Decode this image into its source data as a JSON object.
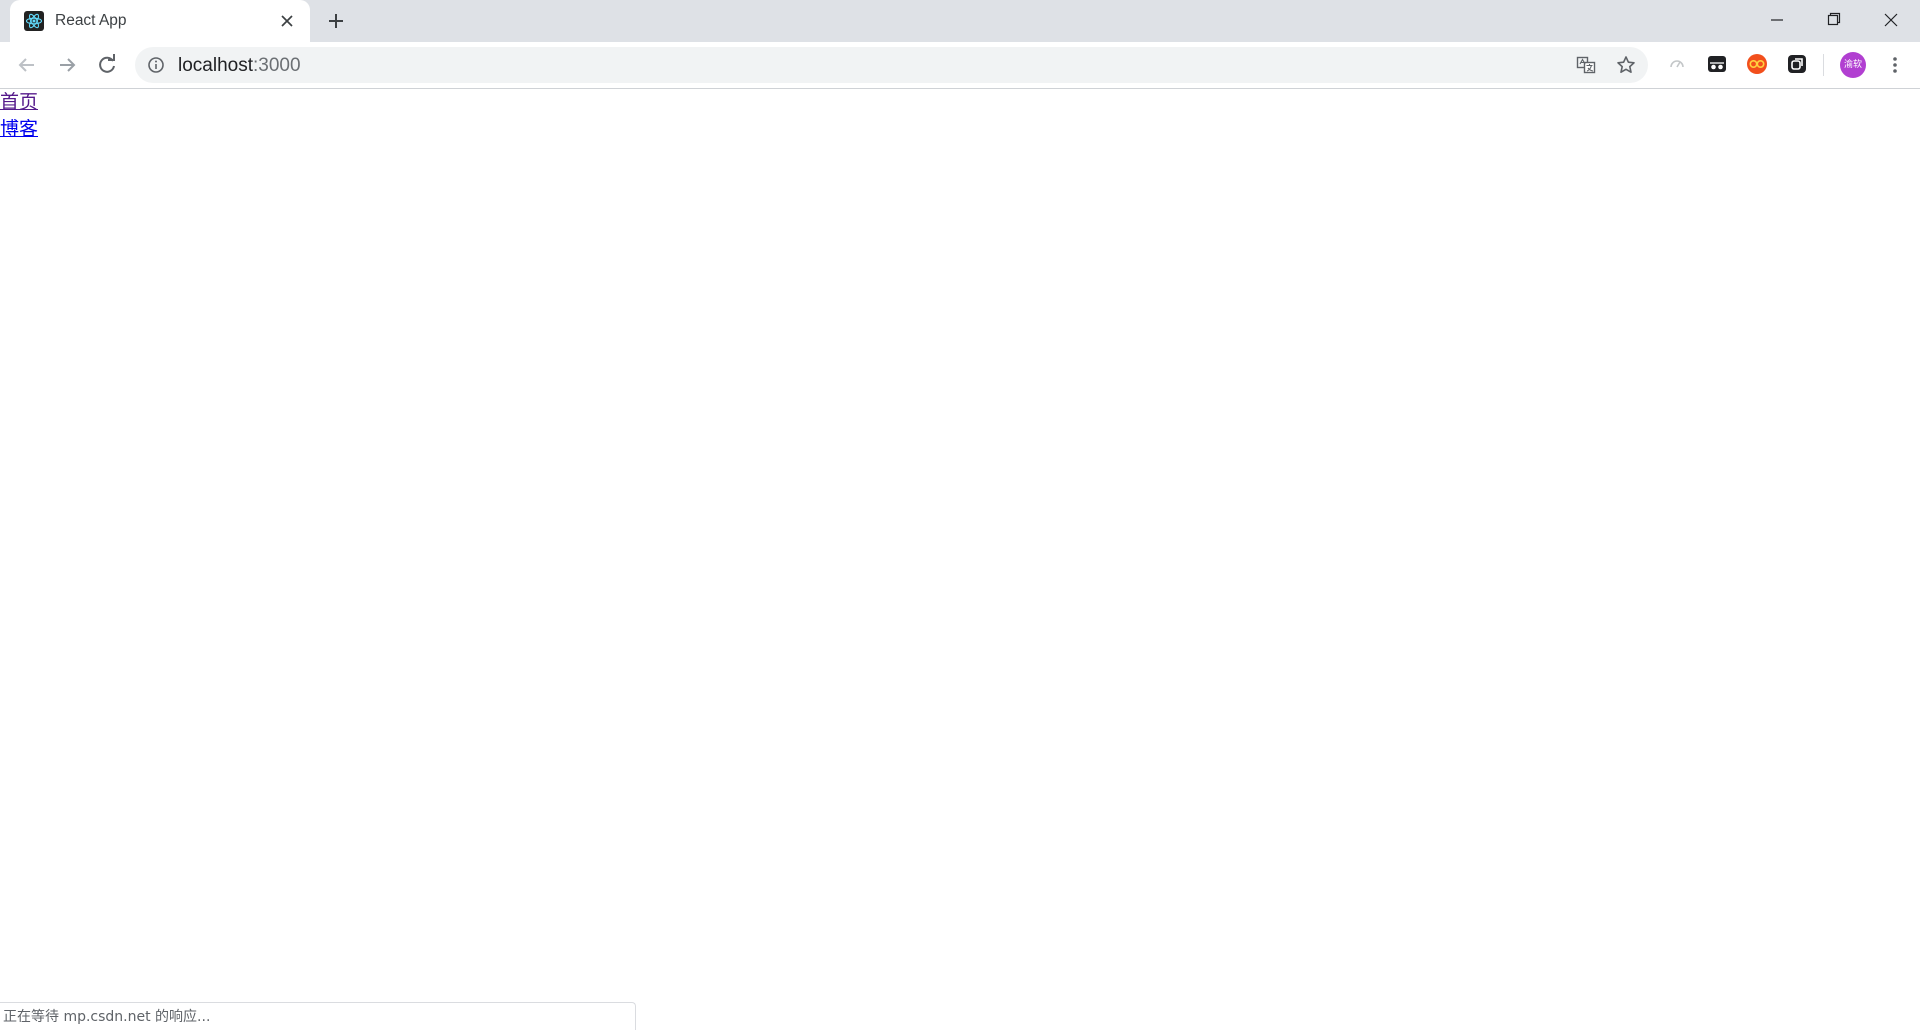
{
  "browser": {
    "tab": {
      "title": "React App",
      "favicon": "react-logo-icon"
    },
    "address_bar": {
      "host": "localhost",
      "port": ":3000"
    },
    "avatar_text": "渝软",
    "status_text": "正在等待 mp.csdn.net 的响应..."
  },
  "page": {
    "links": [
      {
        "label": "首页",
        "visited": true
      },
      {
        "label": "博客",
        "visited": false
      }
    ]
  },
  "colors": {
    "tabstrip_bg": "#dee1e6",
    "omnibox_bg": "#f1f3f4",
    "visited_link": "#551a8b",
    "unvisited_link": "#0000ee",
    "avatar_bg": "#b13fd1"
  }
}
